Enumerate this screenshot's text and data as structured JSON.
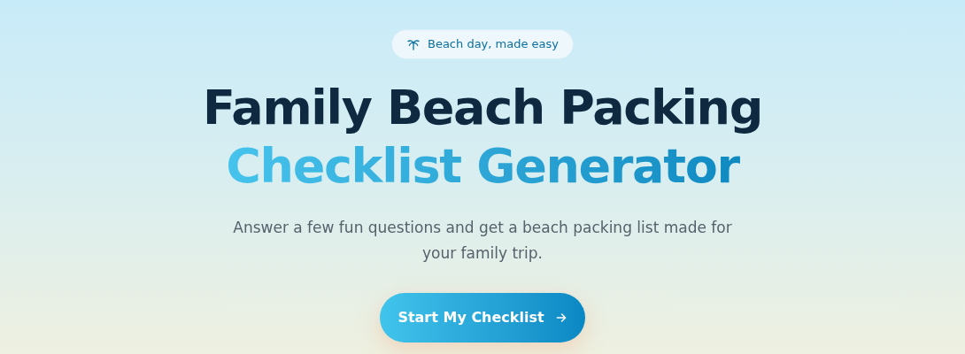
{
  "badge": {
    "text": "Beach day, made easy"
  },
  "title": {
    "line_1": "Family Beach Packing",
    "line_2": "Checklist Generator"
  },
  "subtitle": "Answer a few fun questions and get a beach packing list made for your family trip.",
  "cta_button": {
    "label": "Start My Checklist"
  }
}
